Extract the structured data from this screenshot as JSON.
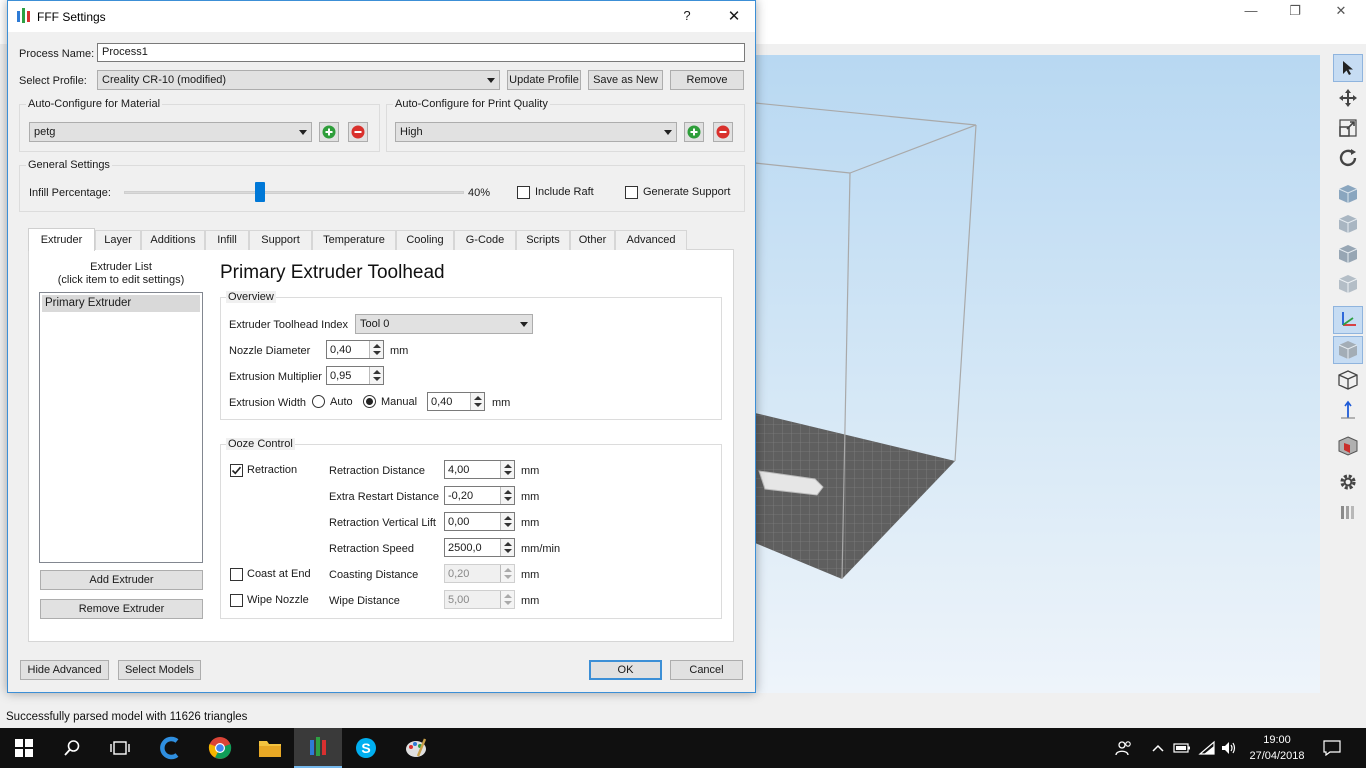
{
  "dialog": {
    "title": "FFF Settings",
    "help_icon": "?",
    "close_icon": "✕"
  },
  "process": {
    "label": "Process Name:",
    "value": "Process1"
  },
  "profile": {
    "label": "Select Profile:",
    "value": "Creality CR-10 (modified)",
    "update_label": "Update Profile",
    "save_as_new_label": "Save as New",
    "remove_label": "Remove"
  },
  "material": {
    "group_title": "Auto-Configure for Material",
    "value": "petg"
  },
  "quality": {
    "group_title": "Auto-Configure for Print Quality",
    "value": "High"
  },
  "general": {
    "group_title": "General Settings",
    "infill_label": "Infill Percentage:",
    "infill_fraction": 0.4,
    "infill_value": "40%",
    "include_raft_label": "Include Raft",
    "include_raft_checked": false,
    "generate_support_label": "Generate Support",
    "generate_support_checked": false
  },
  "tabs": [
    {
      "label": "Extruder",
      "active": true
    },
    {
      "label": "Layer"
    },
    {
      "label": "Additions"
    },
    {
      "label": "Infill"
    },
    {
      "label": "Support"
    },
    {
      "label": "Temperature"
    },
    {
      "label": "Cooling"
    },
    {
      "label": "G-Code"
    },
    {
      "label": "Scripts"
    },
    {
      "label": "Other"
    },
    {
      "label": "Advanced"
    }
  ],
  "extruder_list": {
    "title_line1": "Extruder List",
    "title_line2": "(click item to edit settings)",
    "items": [
      "Primary Extruder"
    ],
    "add_label": "Add Extruder",
    "remove_label": "Remove Extruder"
  },
  "extruder": {
    "heading": "Primary Extruder Toolhead",
    "overview_title": "Overview",
    "toolhead_index_label": "Extruder Toolhead Index",
    "toolhead_index_value": "Tool 0",
    "nozzle_diameter_label": "Nozzle Diameter",
    "nozzle_diameter_value": "0,40",
    "nozzle_diameter_unit": "mm",
    "extrusion_multiplier_label": "Extrusion Multiplier",
    "extrusion_multiplier_value": "0,95",
    "extrusion_width_label": "Extrusion Width",
    "auto_label": "Auto",
    "manual_label": "Manual",
    "extrusion_width_value": "0,40",
    "extrusion_width_unit": "mm"
  },
  "ooze": {
    "title": "Ooze Control",
    "retraction_label": "Retraction",
    "retraction_checked": true,
    "coast_label": "Coast at End",
    "coast_checked": false,
    "wipe_label": "Wipe Nozzle",
    "wipe_checked": false,
    "rows": [
      {
        "label": "Retraction Distance",
        "value": "4,00",
        "unit": "mm",
        "enabled": true
      },
      {
        "label": "Extra Restart Distance",
        "value": "-0,20",
        "unit": "mm",
        "enabled": true
      },
      {
        "label": "Retraction Vertical Lift",
        "value": "0,00",
        "unit": "mm",
        "enabled": true
      },
      {
        "label": "Retraction Speed",
        "value": "2500,0",
        "unit": "mm/min",
        "enabled": true
      },
      {
        "label": "Coasting Distance",
        "value": "0,20",
        "unit": "mm",
        "enabled": false
      },
      {
        "label": "Wipe Distance",
        "value": "5,00",
        "unit": "mm",
        "enabled": false
      }
    ]
  },
  "footer": {
    "hide_advanced_label": "Hide Advanced",
    "select_models_label": "Select Models",
    "ok_label": "OK",
    "cancel_label": "Cancel"
  },
  "status": {
    "text": "Successfully parsed model with 11626 triangles"
  },
  "clock": {
    "time": "19:00",
    "date": "27/04/2018"
  },
  "colors": {
    "accent": "#3c8fd6",
    "slider": "#0078d7",
    "taskbar": "#101010",
    "viewport_sky": "#b8d8f2",
    "add_green": "#2e9e3a",
    "remove_red": "#d9302c"
  },
  "icons": {
    "taskbar": [
      "windows-start-icon",
      "search-icon",
      "task-view-icon",
      "ccleaner-icon",
      "chrome-icon",
      "file-explorer-icon",
      "simplify3d-icon",
      "skype-icon",
      "paint-icon"
    ],
    "tray": [
      "people-icon",
      "chevron-up-icon",
      "battery-icon",
      "wifi-icon",
      "volume-icon",
      "notification-icon"
    ],
    "toolbar": [
      "select-cursor-icon",
      "move-icon",
      "scale-icon",
      "rotate-icon",
      "cube-front-icon",
      "cube-back-icon",
      "cube-left-icon",
      "cube-right-icon",
      "axes-icon",
      "cube-solid-icon",
      "cube-wireframe-icon",
      "z-axis-icon",
      "cube-cut-icon",
      "gear-icon",
      "layers-icon"
    ]
  }
}
